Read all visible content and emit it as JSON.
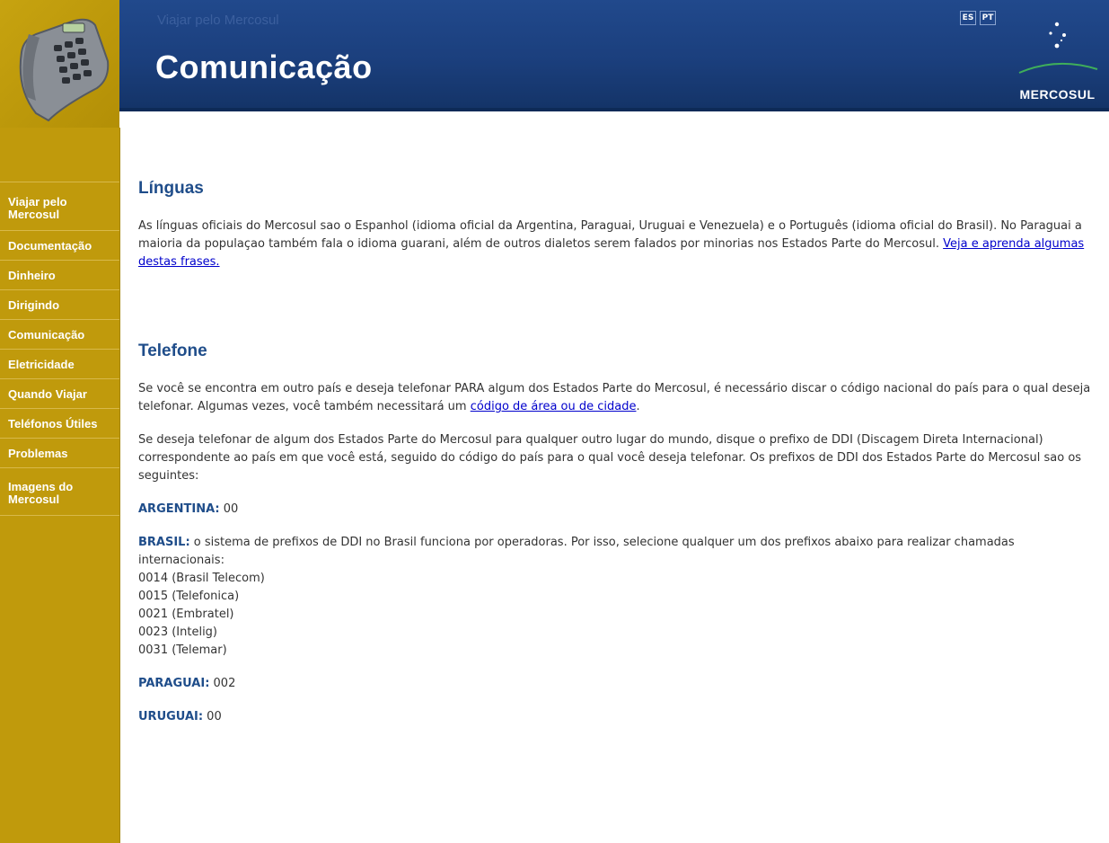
{
  "header": {
    "breadcrumb": "Viajar pelo Mercosul",
    "title": "Comunicação",
    "languages": [
      "ES",
      "PT"
    ],
    "logo_text": "MERCOSUL"
  },
  "sidebar": {
    "items": [
      {
        "label": "Viajar pelo Mercosul"
      },
      {
        "label": "Documentação"
      },
      {
        "label": "Dinheiro"
      },
      {
        "label": "Dirigindo"
      },
      {
        "label": "Comunicação"
      },
      {
        "label": "Eletricidade"
      },
      {
        "label": "Quando Viajar"
      },
      {
        "label": "Teléfonos Útiles"
      },
      {
        "label": "Problemas"
      },
      {
        "label": "Imagens do Mercosul"
      }
    ]
  },
  "main": {
    "linguas": {
      "heading": "Línguas",
      "text": "As línguas oficiais do Mercosul sao o Espanhol (idioma oficial da Argentina, Paraguai, Uruguai e Venezuela) e o Português (idioma oficial do Brasil). No Paraguai a maioria da populaçao também fala o idioma guarani, além de outros dialetos serem falados por minorias nos Estados Parte do Mercosul. ",
      "link": "Veja e aprenda algumas destas frases."
    },
    "telefone": {
      "heading": "Telefone",
      "p1_text": "Se você se encontra em outro país e deseja telefonar PARA algum dos Estados Parte do Mercosul, é necessário discar o código nacional do país para o qual deseja telefonar. Algumas vezes, você também necessitará um ",
      "p1_link": "código de área ou de cidade",
      "p1_end": ".",
      "p2_text": "Se deseja telefonar de algum dos Estados Parte do Mercosul para qualquer outro lugar do mundo, disque o prefixo de DDI (Discagem Direta Internacional) correspondente ao país em que você está, seguido do código do país para o qual você deseja telefonar. Os prefixos de DDI dos Estados Parte do Mercosul sao os seguintes:",
      "argentina_label": "ARGENTINA:",
      "argentina_value": " 00",
      "brasil_label": "BRASIL:",
      "brasil_text": " o sistema de prefixos de DDI no Brasil funciona por operadoras. Por isso, selecione qualquer um dos prefixos abaixo para realizar chamadas internacionais:",
      "brasil_prefixes": [
        "0014 (Brasil Telecom)",
        "0015 (Telefonica)",
        "0021 (Embratel)",
        "0023 (Intelig)",
        "0031 (Telemar)"
      ],
      "paraguai_label": "PARAGUAI:",
      "paraguai_value": " 002",
      "uruguai_label": "URUGUAI:",
      "uruguai_value": " 00"
    }
  },
  "colors": {
    "header_blue": "#1b3f7d",
    "sidebar_gold": "#c09a0c",
    "heading_blue": "#1f4d8a",
    "link_blue": "#0000cc"
  }
}
